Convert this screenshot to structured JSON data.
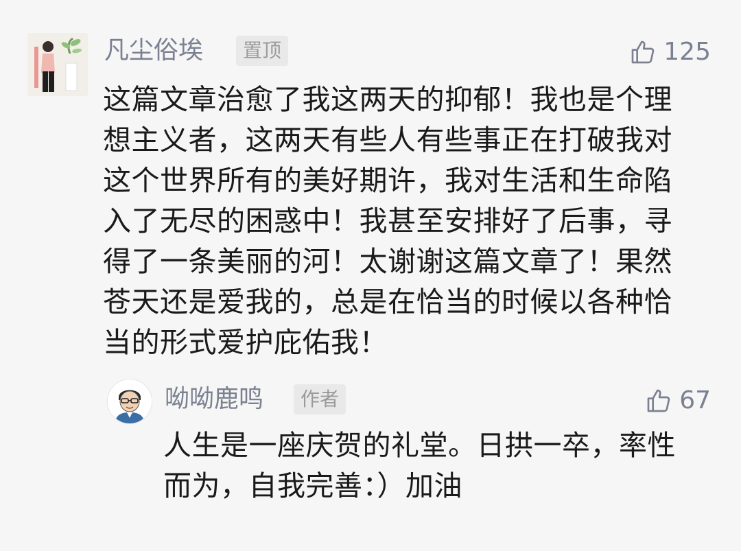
{
  "comment": {
    "username": "凡尘俗埃",
    "badge": "置顶",
    "likes": "125",
    "text": "这篇文章治愈了我这两天的抑郁！我也是个理想主义者，这两天有些人有些事正在打破我对这个世界所有的美好期许，我对生活和生命陷入了无尽的困惑中！我甚至安排好了后事，寻得了一条美丽的河！太谢谢这篇文章了！果然苍天还是爱我的，总是在恰当的时候以各种恰当的形式爱护庇佑我！"
  },
  "reply": {
    "username": "呦呦鹿鸣",
    "badge": "作者",
    "likes": "67",
    "text": "人生是一座庆贺的礼堂。日拱一卒，率性而为，自我完善：）加油"
  },
  "icons": {
    "like": "thumbs-up-icon"
  },
  "colors": {
    "background": "#f6f6f6",
    "username": "#7b8191",
    "badge_bg": "#e9e9e9",
    "text": "#1a1a1a"
  }
}
